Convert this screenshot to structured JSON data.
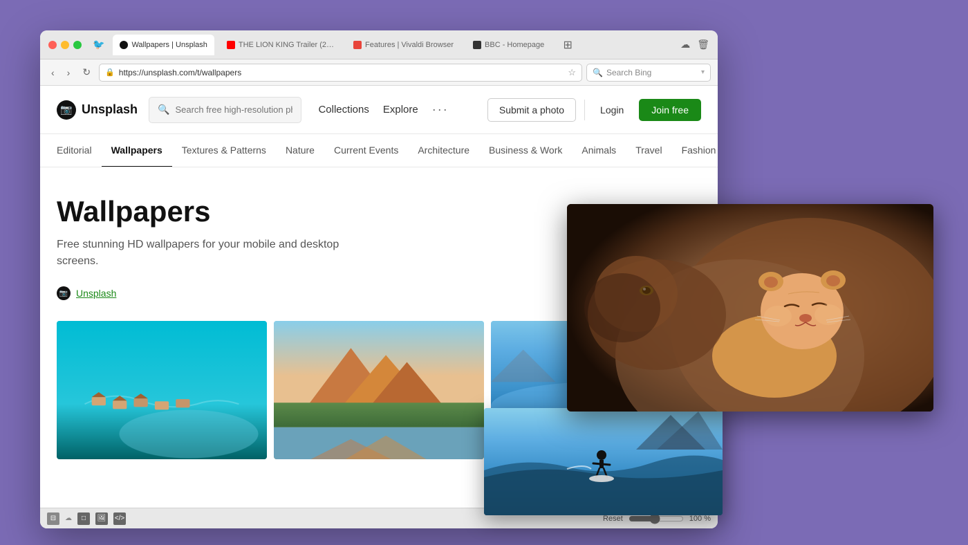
{
  "browser": {
    "tabs": [
      {
        "id": "unsplash",
        "label": "Wallpapers | Unsplash",
        "active": true,
        "favicon": "camera"
      },
      {
        "id": "lion-king",
        "label": "THE LION KING Trailer (2…",
        "active": false,
        "favicon": "youtube"
      },
      {
        "id": "vivaldi",
        "label": "Features | Vivaldi Browser",
        "active": false,
        "favicon": "features"
      },
      {
        "id": "bbc",
        "label": "BBC - Homepage",
        "active": false,
        "favicon": "bbc"
      }
    ],
    "address": "https://unsplash.com/t/wallpapers",
    "search_placeholder": "Search Bing"
  },
  "unsplash": {
    "logo_text": "Unsplash",
    "search_placeholder": "Search free high-resolution ph",
    "nav": {
      "collections": "Collections",
      "explore": "Explore",
      "more": "···"
    },
    "actions": {
      "submit": "Submit a photo",
      "login": "Login",
      "join": "Join free"
    },
    "categories": [
      {
        "id": "editorial",
        "label": "Editorial",
        "active": false
      },
      {
        "id": "wallpapers",
        "label": "Wallpapers",
        "active": true
      },
      {
        "id": "textures",
        "label": "Textures & Patterns",
        "active": false
      },
      {
        "id": "nature",
        "label": "Nature",
        "active": false
      },
      {
        "id": "events",
        "label": "Current Events",
        "active": false
      },
      {
        "id": "architecture",
        "label": "Architecture",
        "active": false
      },
      {
        "id": "business",
        "label": "Business & Work",
        "active": false
      },
      {
        "id": "animals",
        "label": "Animals",
        "active": false
      },
      {
        "id": "travel",
        "label": "Travel",
        "active": false
      },
      {
        "id": "fashion",
        "label": "Fashion",
        "active": false
      }
    ],
    "page": {
      "title": "Wallpapers",
      "subtitle_line1": "Free stunning HD wallpapers for your mobile and desktop",
      "subtitle_line2": "screens.",
      "author": "Unsplash"
    }
  },
  "bottom_bar": {
    "reset_label": "Reset",
    "zoom_value": "100 %"
  }
}
